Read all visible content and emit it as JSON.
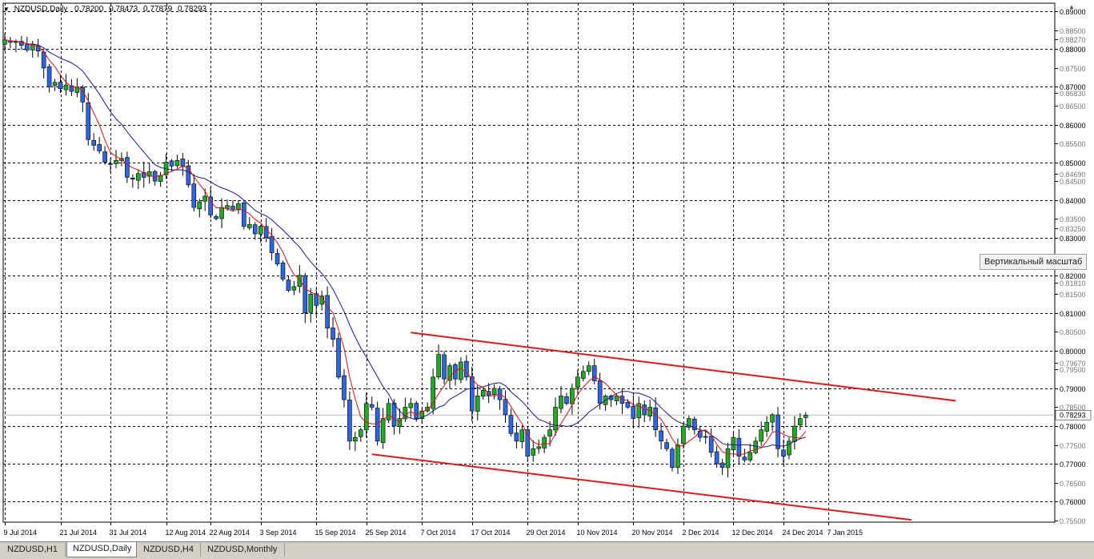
{
  "window": {
    "symbol": "NZDUSD,Daily",
    "ohlc": [
      "0.78200",
      "0.78473",
      "0.77879",
      "0.78293"
    ],
    "current_price": "0.78293",
    "scale_tooltip": "Вертикальный масштаб"
  },
  "tabs": [
    {
      "label": "NZDUSD,H1",
      "active": false
    },
    {
      "label": "NZDUSD,Daily",
      "active": true
    },
    {
      "label": "NZDUSD,H4",
      "active": false
    },
    {
      "label": "NZDUSD,Monthly",
      "active": false
    }
  ],
  "colors": {
    "bull": "#22aa22",
    "bear": "#2e66e0",
    "ma_fast": "#dd1111",
    "ma_slow": "#1a1a8a",
    "channel": "#e01818",
    "grid": "#000000"
  },
  "chart_data": {
    "type": "candlestick",
    "ylim": [
      0.7545,
      0.8922
    ],
    "grid": true,
    "y_ticks": [
      {
        "v": 0.89,
        "label": "0.89000",
        "major": true
      },
      {
        "v": 0.885,
        "label": "0.88500",
        "major": false
      },
      {
        "v": 0.8827,
        "label": "0.88270",
        "major": false
      },
      {
        "v": 0.88,
        "label": "0.88000",
        "major": true
      },
      {
        "v": 0.875,
        "label": "0.87500",
        "major": false
      },
      {
        "v": 0.87,
        "label": "0.87000",
        "major": true
      },
      {
        "v": 0.8683,
        "label": "0.86830",
        "major": false
      },
      {
        "v": 0.865,
        "label": "0.86500",
        "major": false
      },
      {
        "v": 0.86,
        "label": "0.86000",
        "major": true
      },
      {
        "v": 0.855,
        "label": "0.85500",
        "major": false
      },
      {
        "v": 0.85,
        "label": "0.85000",
        "major": true
      },
      {
        "v": 0.8469,
        "label": "0.84690",
        "major": false
      },
      {
        "v": 0.845,
        "label": "0.84500",
        "major": false
      },
      {
        "v": 0.84,
        "label": "0.84000",
        "major": true
      },
      {
        "v": 0.835,
        "label": "0.83500",
        "major": false
      },
      {
        "v": 0.8325,
        "label": "0.83250",
        "major": false
      },
      {
        "v": 0.83,
        "label": "0.83000",
        "major": true
      },
      {
        "v": 0.82,
        "label": "0.82000",
        "major": true
      },
      {
        "v": 0.8181,
        "label": "0.81810",
        "major": false
      },
      {
        "v": 0.815,
        "label": "0.81500",
        "major": false
      },
      {
        "v": 0.81,
        "label": "0.81000",
        "major": true
      },
      {
        "v": 0.805,
        "label": "0.80500",
        "major": false
      },
      {
        "v": 0.8,
        "label": "0.80000",
        "major": true
      },
      {
        "v": 0.7967,
        "label": "0.79670",
        "major": false
      },
      {
        "v": 0.795,
        "label": "0.79500",
        "major": false
      },
      {
        "v": 0.79,
        "label": "0.79000",
        "major": true
      },
      {
        "v": 0.785,
        "label": "0.78500",
        "major": false
      },
      {
        "v": 0.78,
        "label": "0.78000",
        "major": true
      },
      {
        "v": 0.775,
        "label": "0.77500",
        "major": false
      },
      {
        "v": 0.77,
        "label": "0.77000",
        "major": true
      },
      {
        "v": 0.765,
        "label": "0.76500",
        "major": false
      },
      {
        "v": 0.76,
        "label": "0.76000",
        "major": true
      },
      {
        "v": 0.755,
        "label": "0.75500",
        "major": false
      }
    ],
    "x_labels": [
      {
        "bar": 0,
        "label": "9 Jul 2014"
      },
      {
        "bar": 10,
        "label": "21 Jul 2014"
      },
      {
        "bar": 19,
        "label": "31 Jul 2014"
      },
      {
        "bar": 29,
        "label": "12 Aug 2014"
      },
      {
        "bar": 37,
        "label": "22 Aug 2014"
      },
      {
        "bar": 46,
        "label": "3 Sep 2014"
      },
      {
        "bar": 56,
        "label": "15 Sep 2014"
      },
      {
        "bar": 65,
        "label": "25 Sep 2014"
      },
      {
        "bar": 75,
        "label": "7 Oct 2014"
      },
      {
        "bar": 84,
        "label": "17 Oct 2014"
      },
      {
        "bar": 94,
        "label": "29 Oct 2014"
      },
      {
        "bar": 103,
        "label": "10 Nov 2014"
      },
      {
        "bar": 113,
        "label": "20 Nov 2014"
      },
      {
        "bar": 122,
        "label": "2 Dec 2014"
      },
      {
        "bar": 131,
        "label": "12 Dec 2014"
      },
      {
        "bar": 140,
        "label": "24 Dec 2014"
      },
      {
        "bar": 148,
        "label": "7 Jan 2015"
      }
    ],
    "closes": [
      0.8825,
      0.8818,
      0.882,
      0.881,
      0.8798,
      0.8812,
      0.8795,
      0.875,
      0.87,
      0.8712,
      0.8695,
      0.8705,
      0.8688,
      0.87,
      0.866,
      0.856,
      0.8545,
      0.853,
      0.85,
      0.8495,
      0.8505,
      0.851,
      0.846,
      0.8455,
      0.847,
      0.846,
      0.8475,
      0.845,
      0.8465,
      0.85,
      0.849,
      0.8505,
      0.849,
      0.844,
      0.838,
      0.8395,
      0.841,
      0.836,
      0.835,
      0.838,
      0.8385,
      0.8375,
      0.839,
      0.833,
      0.8335,
      0.831,
      0.833,
      0.83,
      0.826,
      0.823,
      0.819,
      0.816,
      0.817,
      0.82,
      0.81,
      0.815,
      0.812,
      0.8145,
      0.806,
      0.803,
      0.793,
      0.787,
      0.776,
      0.777,
      0.779,
      0.786,
      0.785,
      0.776,
      0.782,
      0.786,
      0.78,
      0.782,
      0.785,
      0.786,
      0.782,
      0.784,
      0.785,
      0.793,
      0.799,
      0.7925,
      0.796,
      0.7925,
      0.797,
      0.793,
      0.784,
      0.788,
      0.7895,
      0.788,
      0.79,
      0.787,
      0.783,
      0.778,
      0.776,
      0.779,
      0.772,
      0.774,
      0.7745,
      0.777,
      0.779,
      0.785,
      0.788,
      0.786,
      0.79,
      0.793,
      0.7945,
      0.796,
      0.792,
      0.786,
      0.788,
      0.787,
      0.788,
      0.786,
      0.785,
      0.782,
      0.786,
      0.783,
      0.785,
      0.779,
      0.776,
      0.774,
      0.769,
      0.775,
      0.78,
      0.782,
      0.779,
      0.777,
      0.777,
      0.773,
      0.77,
      0.769,
      0.774,
      0.777,
      0.772,
      0.771,
      0.773,
      0.776,
      0.779,
      0.781,
      0.783,
      0.774,
      0.772,
      0.776,
      0.78,
      0.782,
      0.7829
    ]
  }
}
